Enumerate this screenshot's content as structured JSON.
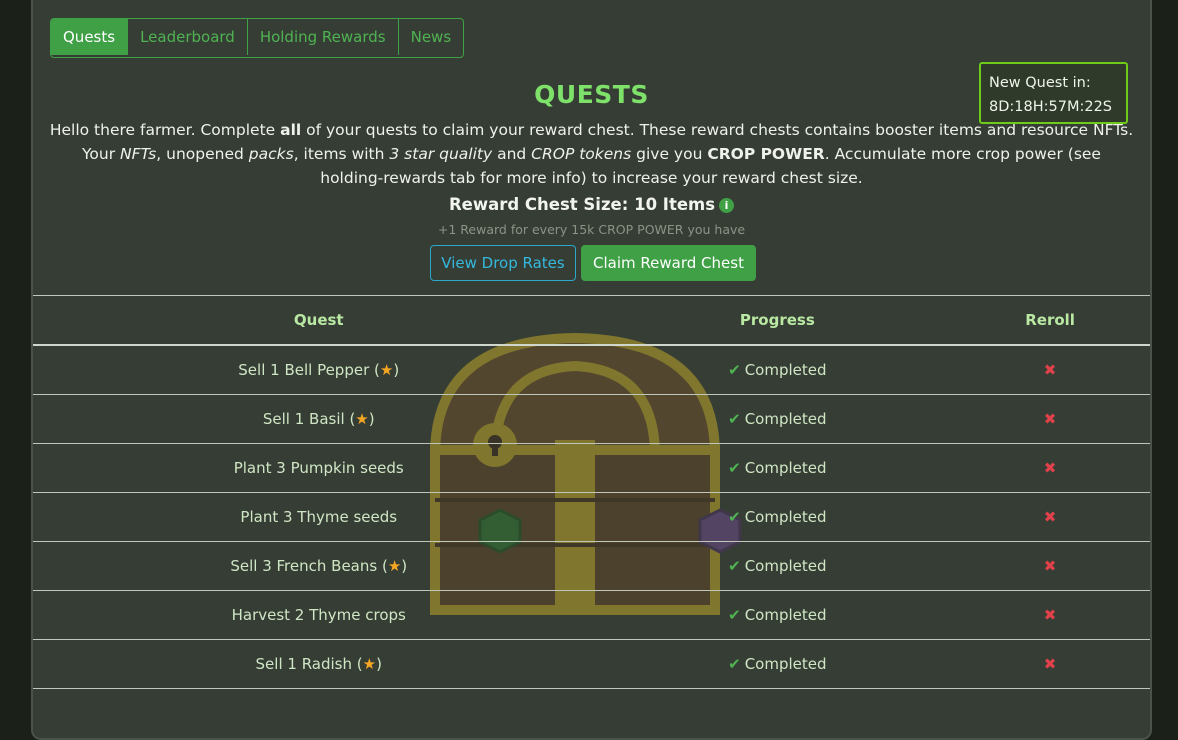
{
  "tabs": [
    {
      "label": "Quests",
      "active": true
    },
    {
      "label": "Leaderboard",
      "active": false
    },
    {
      "label": "Holding Rewards",
      "active": false
    },
    {
      "label": "News",
      "active": false
    }
  ],
  "timer": {
    "label": "New Quest in:",
    "value": "8D:18H:57M:22S"
  },
  "page_title": "QUESTS",
  "intro": {
    "p1": "Hello there farmer. Complete ",
    "b1": "all",
    "p2": " of your quests to claim your reward chest. These reward chests contains booster items and resource NFTs. Your ",
    "i1": "NFTs",
    "p3": ", unopened ",
    "i2": "packs",
    "p4": ", items with ",
    "i3": "3 star quality",
    "p5": " and ",
    "i4": "CROP tokens",
    "p6": " give you ",
    "b2": "CROP POWER",
    "p7": ". Accumulate more crop power (see holding-rewards tab for more info) to increase your reward chest size."
  },
  "chest_size": "Reward Chest Size: 10 Items",
  "bonus_text": "+1 Reward for every 15k CROP POWER you have",
  "buttons": {
    "drop_rates": "View Drop Rates",
    "claim": "Claim Reward Chest"
  },
  "table": {
    "headers": [
      "Quest",
      "Progress",
      "Reroll"
    ],
    "rows": [
      {
        "quest": "Sell 1 Bell Pepper (",
        "star": true,
        "progress": "Completed"
      },
      {
        "quest": "Sell 1 Basil (",
        "star": true,
        "progress": "Completed"
      },
      {
        "quest": "Plant 3 Pumpkin seeds",
        "star": false,
        "progress": "Completed"
      },
      {
        "quest": "Plant 3 Thyme seeds",
        "star": false,
        "progress": "Completed"
      },
      {
        "quest": "Sell 3 French Beans (",
        "star": true,
        "progress": "Completed"
      },
      {
        "quest": "Harvest 2 Thyme crops",
        "star": false,
        "progress": "Completed"
      },
      {
        "quest": "Sell 1 Radish (",
        "star": true,
        "progress": "Completed"
      }
    ]
  },
  "icons": {
    "info": "info-icon",
    "check": "check-icon",
    "star": "star-icon",
    "reroll": "x-icon",
    "chest": "treasure-chest-image"
  },
  "colors": {
    "accent": "#3fa046",
    "title": "#7ee26a",
    "timer_border": "#6ecb1a",
    "reroll": "#e0414a",
    "info_button": "#34b9dd"
  }
}
